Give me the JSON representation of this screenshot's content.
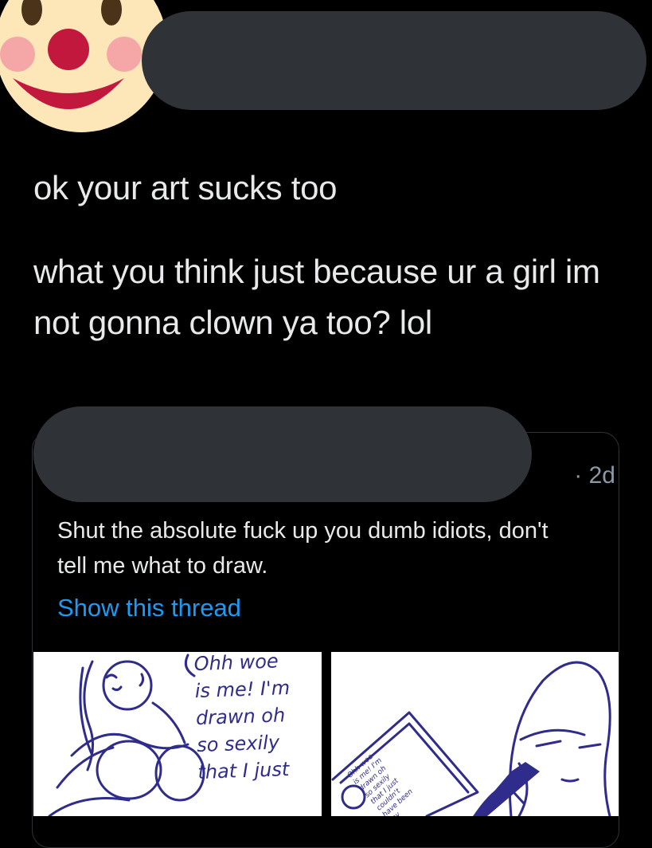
{
  "reply": {
    "line1": "ok your art sucks too",
    "line2": "what you think just because ur a girl im not gonna clown ya too? lol"
  },
  "quoted_tweet": {
    "time": "· 2d",
    "text": "Shut the absolute fuck up you dumb idiots, don't tell me what to draw.",
    "show_thread": "Show this thread"
  },
  "comic": {
    "panel1_caption": "Ohh woe\nis me! I'm\ndrawn oh\nso sexily\nthat I just",
    "panel2_mini_caption": "Ohh woe\nis me! I'm\ndrawn oh\nso sexily\nthat I just\ncouldn't\nhave been\nany"
  },
  "colors": {
    "background": "#000000",
    "text": "#e7e9ea",
    "link": "#1d9bf0",
    "muted": "#8b98a5",
    "redaction": "#2f3237",
    "ink": "#2f2c8c"
  },
  "icons": {
    "avatar": "clown-face-emoji"
  }
}
